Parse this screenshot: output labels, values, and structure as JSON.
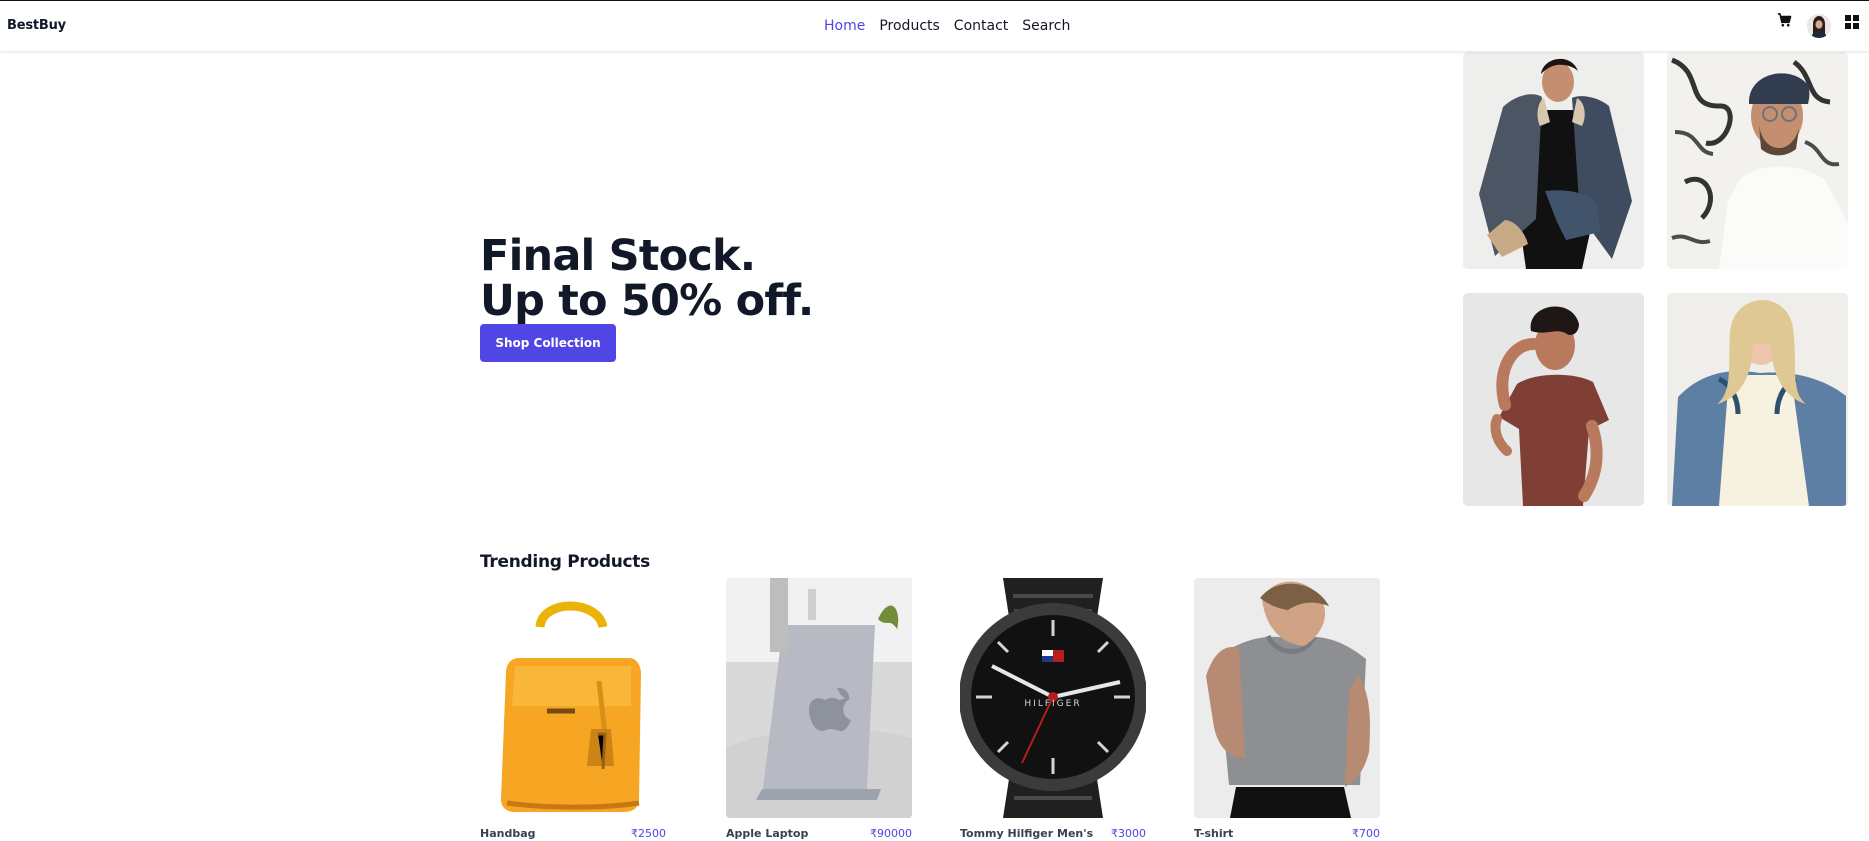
{
  "nav": {
    "brand": "BestBuy",
    "links": [
      "Home",
      "Products",
      "Contact",
      "Search"
    ],
    "active": "Home"
  },
  "icons": {
    "cart": "cart-icon",
    "avatar": "avatar",
    "menu": "grid-icon"
  },
  "hero": {
    "line1": "Final Stock.",
    "line2": "Up to 50% off.",
    "button": "Shop Collection"
  },
  "hero_images": [
    {
      "name": "woman-denim-jacket-image"
    },
    {
      "name": "man-beanie-image"
    },
    {
      "name": "man-brown-tshirt-image"
    },
    {
      "name": "woman-denim-jacket-blonde-image"
    }
  ],
  "trending": {
    "title": "Trending Products",
    "products": [
      {
        "name": "Handbag",
        "price": "₹2500"
      },
      {
        "name": "Apple Laptop",
        "price": "₹90000"
      },
      {
        "name": "Tommy Hilfiger Men's",
        "price": "₹3000"
      },
      {
        "name": "T-shirt",
        "price": "₹700"
      }
    ]
  },
  "colors": {
    "accent": "#4f46e5",
    "text": "#111827"
  }
}
